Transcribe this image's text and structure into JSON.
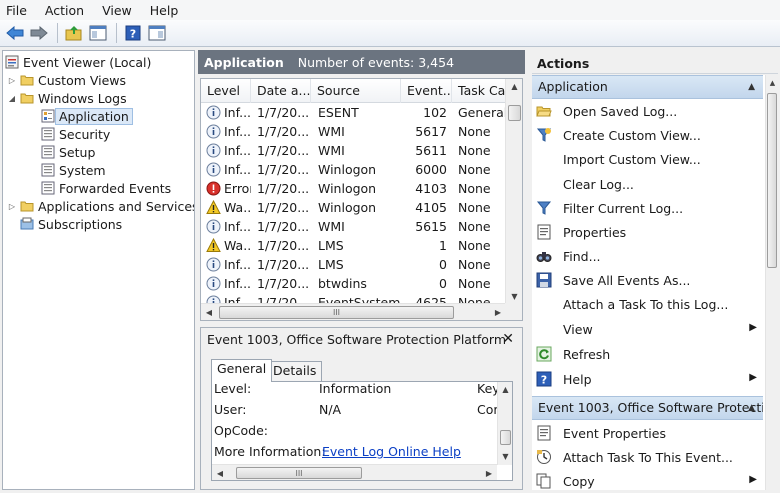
{
  "menu": [
    "File",
    "Action",
    "View",
    "Help"
  ],
  "tree": {
    "root": "Event Viewer (Local)",
    "custom_views": "Custom Views",
    "windows_logs": "Windows Logs",
    "application": "Application",
    "security": "Security",
    "setup": "Setup",
    "system": "System",
    "forwarded": "Forwarded Events",
    "apps_services": "Applications and Services Lo",
    "subscriptions": "Subscriptions"
  },
  "log_header": {
    "title": "Application",
    "count": "Number of events: 3,454"
  },
  "columns": [
    "Level",
    "Date a...",
    "Source",
    "Event...",
    "Task Cate"
  ],
  "events": [
    {
      "level": "Inf...",
      "type": "info",
      "date": "1/7/20...",
      "source": "ESENT",
      "event": "102",
      "task": "General"
    },
    {
      "level": "Inf...",
      "type": "info",
      "date": "1/7/20...",
      "source": "WMI",
      "event": "5617",
      "task": "None"
    },
    {
      "level": "Inf...",
      "type": "info",
      "date": "1/7/20...",
      "source": "WMI",
      "event": "5611",
      "task": "None"
    },
    {
      "level": "Inf...",
      "type": "info",
      "date": "1/7/20...",
      "source": "Winlogon",
      "event": "6000",
      "task": "None"
    },
    {
      "level": "Error",
      "type": "error",
      "date": "1/7/20...",
      "source": "Winlogon",
      "event": "4103",
      "task": "None"
    },
    {
      "level": "Wa...",
      "type": "warning",
      "date": "1/7/20...",
      "source": "Winlogon",
      "event": "4105",
      "task": "None"
    },
    {
      "level": "Inf...",
      "type": "info",
      "date": "1/7/20...",
      "source": "WMI",
      "event": "5615",
      "task": "None"
    },
    {
      "level": "Wa...",
      "type": "warning",
      "date": "1/7/20...",
      "source": "LMS",
      "event": "1",
      "task": "None"
    },
    {
      "level": "Inf...",
      "type": "info",
      "date": "1/7/20...",
      "source": "LMS",
      "event": "0",
      "task": "None"
    },
    {
      "level": "Inf...",
      "type": "info",
      "date": "1/7/20...",
      "source": "btwdins",
      "event": "0",
      "task": "None"
    },
    {
      "level": "Inf...",
      "type": "info",
      "date": "1/7/20...",
      "source": "EventSystem",
      "event": "4625",
      "task": "None"
    }
  ],
  "detail": {
    "title": "Event 1003, Office Software Protection Platform",
    "tabs": [
      "General",
      "Details"
    ],
    "rows": [
      {
        "label": "Level:",
        "value": "Information",
        "extra": "Key"
      },
      {
        "label": "User:",
        "value": "N/A",
        "extra": "Cor"
      },
      {
        "label": "OpCode:",
        "value": "",
        "extra": ""
      },
      {
        "label": "More Information:",
        "value": "Event Log Online Help",
        "extra": ""
      }
    ]
  },
  "actions": {
    "header": "Actions",
    "section1": "Application",
    "items1": [
      "Open Saved Log...",
      "Create Custom View...",
      "Import Custom View...",
      "Clear Log...",
      "Filter Current Log...",
      "Properties",
      "Find...",
      "Save All Events As...",
      "Attach a Task To this Log...",
      "View",
      "Refresh",
      "Help"
    ],
    "section2": "Event 1003, Office Software Protecti...",
    "items2": [
      "Event Properties",
      "Attach Task To This Event...",
      "Copy"
    ]
  },
  "colors": {
    "accent": "#c7daef",
    "header_bg": "#6b7480",
    "link": "#0b3fc5"
  }
}
